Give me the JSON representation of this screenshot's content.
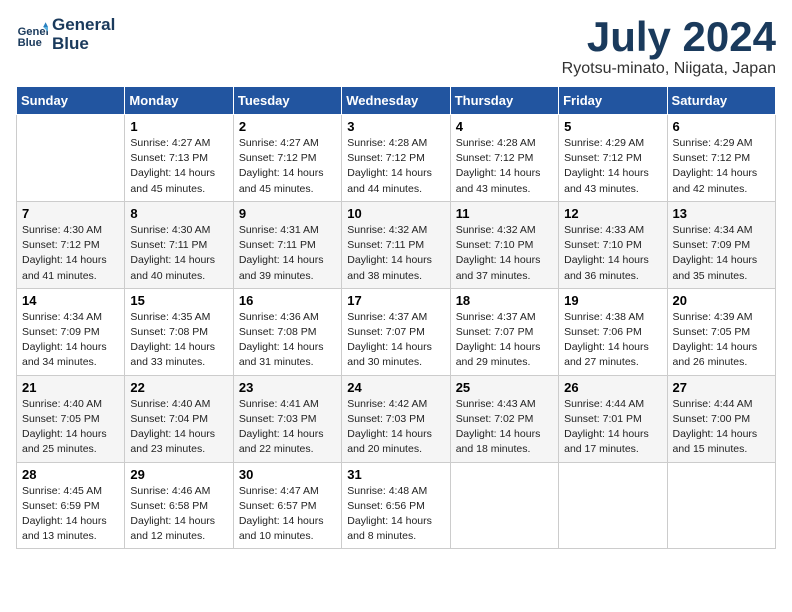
{
  "logo": {
    "line1": "General",
    "line2": "Blue"
  },
  "title": "July 2024",
  "location": "Ryotsu-minato, Niigata, Japan",
  "days_of_week": [
    "Sunday",
    "Monday",
    "Tuesday",
    "Wednesday",
    "Thursday",
    "Friday",
    "Saturday"
  ],
  "weeks": [
    [
      {
        "day": "",
        "content": ""
      },
      {
        "day": "1",
        "content": "Sunrise: 4:27 AM\nSunset: 7:13 PM\nDaylight: 14 hours\nand 45 minutes."
      },
      {
        "day": "2",
        "content": "Sunrise: 4:27 AM\nSunset: 7:12 PM\nDaylight: 14 hours\nand 45 minutes."
      },
      {
        "day": "3",
        "content": "Sunrise: 4:28 AM\nSunset: 7:12 PM\nDaylight: 14 hours\nand 44 minutes."
      },
      {
        "day": "4",
        "content": "Sunrise: 4:28 AM\nSunset: 7:12 PM\nDaylight: 14 hours\nand 43 minutes."
      },
      {
        "day": "5",
        "content": "Sunrise: 4:29 AM\nSunset: 7:12 PM\nDaylight: 14 hours\nand 43 minutes."
      },
      {
        "day": "6",
        "content": "Sunrise: 4:29 AM\nSunset: 7:12 PM\nDaylight: 14 hours\nand 42 minutes."
      }
    ],
    [
      {
        "day": "7",
        "content": "Sunrise: 4:30 AM\nSunset: 7:12 PM\nDaylight: 14 hours\nand 41 minutes."
      },
      {
        "day": "8",
        "content": "Sunrise: 4:30 AM\nSunset: 7:11 PM\nDaylight: 14 hours\nand 40 minutes."
      },
      {
        "day": "9",
        "content": "Sunrise: 4:31 AM\nSunset: 7:11 PM\nDaylight: 14 hours\nand 39 minutes."
      },
      {
        "day": "10",
        "content": "Sunrise: 4:32 AM\nSunset: 7:11 PM\nDaylight: 14 hours\nand 38 minutes."
      },
      {
        "day": "11",
        "content": "Sunrise: 4:32 AM\nSunset: 7:10 PM\nDaylight: 14 hours\nand 37 minutes."
      },
      {
        "day": "12",
        "content": "Sunrise: 4:33 AM\nSunset: 7:10 PM\nDaylight: 14 hours\nand 36 minutes."
      },
      {
        "day": "13",
        "content": "Sunrise: 4:34 AM\nSunset: 7:09 PM\nDaylight: 14 hours\nand 35 minutes."
      }
    ],
    [
      {
        "day": "14",
        "content": "Sunrise: 4:34 AM\nSunset: 7:09 PM\nDaylight: 14 hours\nand 34 minutes."
      },
      {
        "day": "15",
        "content": "Sunrise: 4:35 AM\nSunset: 7:08 PM\nDaylight: 14 hours\nand 33 minutes."
      },
      {
        "day": "16",
        "content": "Sunrise: 4:36 AM\nSunset: 7:08 PM\nDaylight: 14 hours\nand 31 minutes."
      },
      {
        "day": "17",
        "content": "Sunrise: 4:37 AM\nSunset: 7:07 PM\nDaylight: 14 hours\nand 30 minutes."
      },
      {
        "day": "18",
        "content": "Sunrise: 4:37 AM\nSunset: 7:07 PM\nDaylight: 14 hours\nand 29 minutes."
      },
      {
        "day": "19",
        "content": "Sunrise: 4:38 AM\nSunset: 7:06 PM\nDaylight: 14 hours\nand 27 minutes."
      },
      {
        "day": "20",
        "content": "Sunrise: 4:39 AM\nSunset: 7:05 PM\nDaylight: 14 hours\nand 26 minutes."
      }
    ],
    [
      {
        "day": "21",
        "content": "Sunrise: 4:40 AM\nSunset: 7:05 PM\nDaylight: 14 hours\nand 25 minutes."
      },
      {
        "day": "22",
        "content": "Sunrise: 4:40 AM\nSunset: 7:04 PM\nDaylight: 14 hours\nand 23 minutes."
      },
      {
        "day": "23",
        "content": "Sunrise: 4:41 AM\nSunset: 7:03 PM\nDaylight: 14 hours\nand 22 minutes."
      },
      {
        "day": "24",
        "content": "Sunrise: 4:42 AM\nSunset: 7:03 PM\nDaylight: 14 hours\nand 20 minutes."
      },
      {
        "day": "25",
        "content": "Sunrise: 4:43 AM\nSunset: 7:02 PM\nDaylight: 14 hours\nand 18 minutes."
      },
      {
        "day": "26",
        "content": "Sunrise: 4:44 AM\nSunset: 7:01 PM\nDaylight: 14 hours\nand 17 minutes."
      },
      {
        "day": "27",
        "content": "Sunrise: 4:44 AM\nSunset: 7:00 PM\nDaylight: 14 hours\nand 15 minutes."
      }
    ],
    [
      {
        "day": "28",
        "content": "Sunrise: 4:45 AM\nSunset: 6:59 PM\nDaylight: 14 hours\nand 13 minutes."
      },
      {
        "day": "29",
        "content": "Sunrise: 4:46 AM\nSunset: 6:58 PM\nDaylight: 14 hours\nand 12 minutes."
      },
      {
        "day": "30",
        "content": "Sunrise: 4:47 AM\nSunset: 6:57 PM\nDaylight: 14 hours\nand 10 minutes."
      },
      {
        "day": "31",
        "content": "Sunrise: 4:48 AM\nSunset: 6:56 PM\nDaylight: 14 hours\nand 8 minutes."
      },
      {
        "day": "",
        "content": ""
      },
      {
        "day": "",
        "content": ""
      },
      {
        "day": "",
        "content": ""
      }
    ]
  ]
}
